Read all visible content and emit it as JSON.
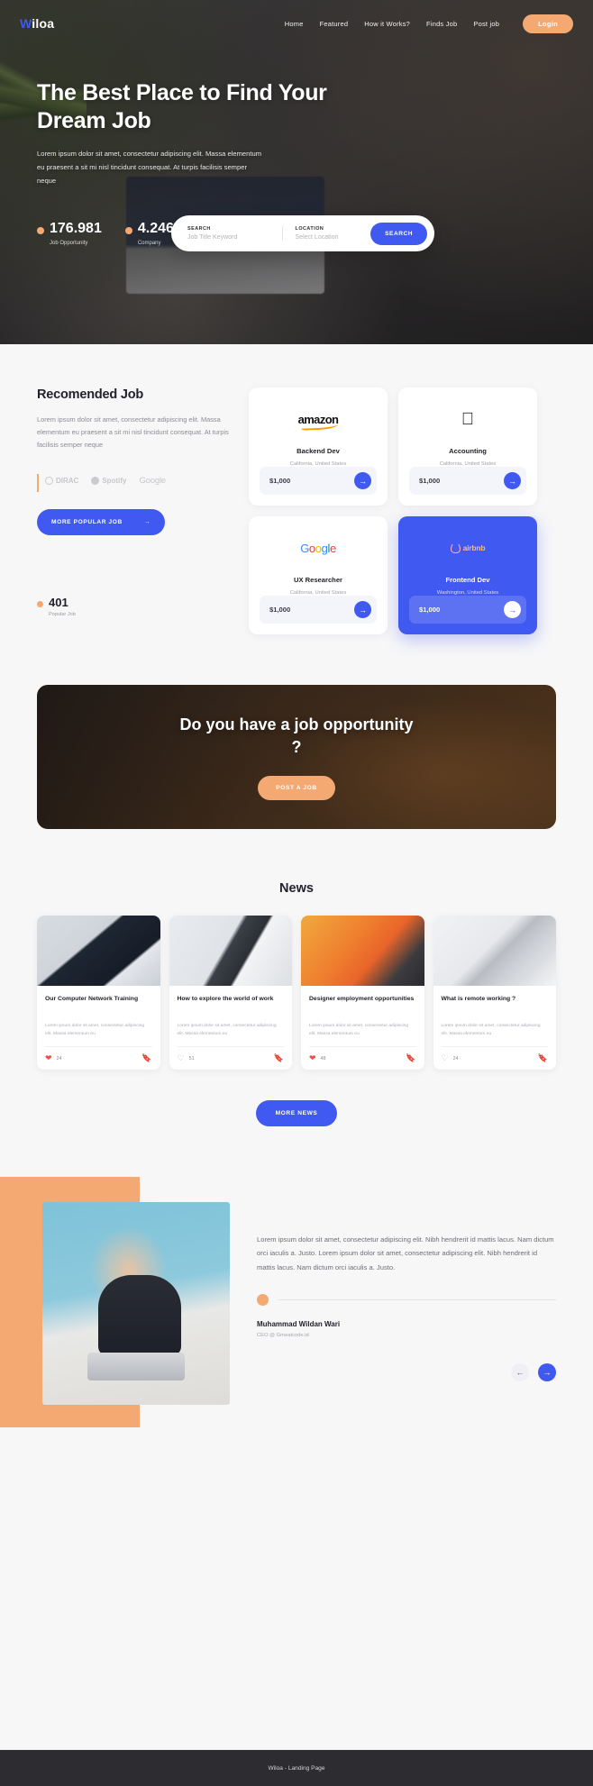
{
  "navbar": {
    "logo_w": "W",
    "logo_rest": "iloa",
    "links": [
      {
        "label": "Home"
      },
      {
        "label": "Featured"
      },
      {
        "label": "How it Works?"
      },
      {
        "label": "Finds Job"
      },
      {
        "label": "Post job"
      }
    ],
    "login_label": "Login"
  },
  "hero": {
    "title": "The Best Place to Find Your Dream Job",
    "subtitle": "Lorem ipsum dolor sit amet, consectetur adipiscing elit. Massa elementum eu praesent a sit mi nisl tincidunt consequat. At turpis facilisis semper neque",
    "stats": [
      {
        "value": "176.981",
        "label": "Job Opportunity"
      },
      {
        "value": "4.246",
        "label": "Company"
      }
    ],
    "search": {
      "search_label": "SEARCH",
      "search_placeholder": "Job Title Keyword",
      "location_label": "LOCATION",
      "location_placeholder": "Select Location",
      "button_label": "SEARCH"
    }
  },
  "recommended": {
    "title": "Recomended Job",
    "text": "Lorem ipsum dolor sit amet, consectetur adipiscing elit. Massa elementum eu praesent a sit mi nisl tincidunt consequat. At turpis facilisis semper neque",
    "brands": [
      {
        "name": "DIRAC"
      },
      {
        "name": "Spotify"
      },
      {
        "name": "Google"
      }
    ],
    "more_button": "MORE POPULAR JOB",
    "more_button_icon": "→",
    "popular": {
      "value": "401",
      "label": "Popular Job"
    },
    "jobs": [
      {
        "company": "amazon",
        "role": "Backend Dev",
        "location": "California, United States",
        "price": "$1,000",
        "arrow": "→",
        "featured": false
      },
      {
        "company": "apple",
        "role": "Accounting",
        "location": "California, United States",
        "price": "$1,000",
        "arrow": "→",
        "featured": false
      },
      {
        "company": "google",
        "role": "UX Researcher",
        "location": "California, United States",
        "price": "$1,000",
        "arrow": "→",
        "featured": false
      },
      {
        "company": "airbnb",
        "role": "Frontend Dev",
        "location": "Washington, United States",
        "price": "$1,000",
        "arrow": "→",
        "featured": true
      }
    ]
  },
  "cta": {
    "title": "Do you have a job opportunity ?",
    "button_label": "POST A JOB"
  },
  "news": {
    "title": "News",
    "cards": [
      {
        "headline": "Our Computer Network Training",
        "text": "Lorem ipsum dolor sit amet, consectetur adipiscing elit. Massa elementum eu",
        "likes": "24",
        "liked": true,
        "saved": false
      },
      {
        "headline": "How to explore the world of work",
        "text": "Lorem ipsum dolor sit amet, consectetur adipiscing elit. Massa elementum eu",
        "likes": "51",
        "liked": false,
        "saved": false
      },
      {
        "headline": "Designer employment opportunities",
        "text": "Lorem ipsum dolor sit amet, consectetur adipiscing elit. Massa elementum eu",
        "likes": "48",
        "liked": true,
        "saved": false
      },
      {
        "headline": "What is remote working ?",
        "text": "Lorem ipsum dolor sit amet, consectetur adipiscing elit. Massa elementum eu",
        "likes": "24",
        "liked": false,
        "saved": true
      }
    ],
    "more_button": "MORE NEWS"
  },
  "testimonial": {
    "quote": "Lorem ipsum dolor sit amet, consectetur adipiscing elit. Nibh hendrerit id mattis lacus. Nam dictum orci iaculis a. Justo. Lorem ipsum dolor sit amet, consectetur adipiscing elit. Nibh hendrerit id mattis lacus. Nam dictum orci iaculis a. Justo.",
    "name": "Muhammad Wildan Wari",
    "role": "CEO @ Gmeatcode.id",
    "prev_icon": "←",
    "next_icon": "→"
  },
  "footer": {
    "text": "Wiloa - Landing Page"
  },
  "colors": {
    "primary": "#4059f0",
    "accent": "#f4a973",
    "dark": "#2c2c31",
    "page_bg": "#f7f7f8"
  }
}
